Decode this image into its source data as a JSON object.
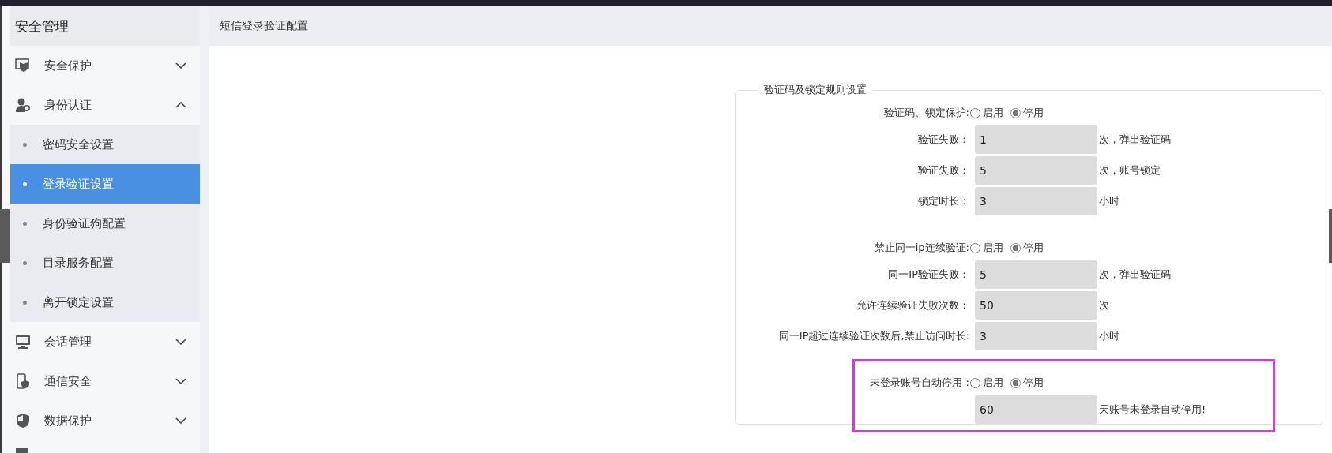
{
  "sidebar": {
    "title": "安全管理",
    "items": [
      {
        "label": "安全保护",
        "expanded": false
      },
      {
        "label": "身份认证",
        "expanded": true,
        "children": [
          {
            "label": "密码安全设置",
            "selected": false
          },
          {
            "label": "登录验证设置",
            "selected": true
          },
          {
            "label": "身份验证狗配置",
            "selected": false
          },
          {
            "label": "目录服务配置",
            "selected": false
          },
          {
            "label": "离开锁定设置",
            "selected": false
          }
        ]
      },
      {
        "label": "会话管理",
        "expanded": false
      },
      {
        "label": "通信安全",
        "expanded": false
      },
      {
        "label": "数据保护",
        "expanded": false
      }
    ]
  },
  "breadcrumb": "短信登录验证配置",
  "fieldset": {
    "legend": "验证码及锁定规则设置",
    "groups": [
      {
        "highlighted": false,
        "rows": [
          {
            "kind": "radio",
            "label": "验证码、锁定保护:",
            "options": [
              {
                "label": "启用",
                "selected": false
              },
              {
                "label": "停用",
                "selected": true
              }
            ]
          },
          {
            "kind": "input",
            "label": "验证失败：",
            "value": "1",
            "suffix": "次，弹出验证码"
          },
          {
            "kind": "input",
            "label": "验证失败：",
            "value": "5",
            "suffix": "次，账号锁定"
          },
          {
            "kind": "input",
            "label": "锁定时长：",
            "value": "3",
            "suffix": "小时"
          }
        ]
      },
      {
        "highlighted": false,
        "rows": [
          {
            "kind": "radio",
            "label": "禁止同一ip连续验证:",
            "options": [
              {
                "label": "启用",
                "selected": false
              },
              {
                "label": "停用",
                "selected": true
              }
            ]
          },
          {
            "kind": "input",
            "label": "同一IP验证失败：",
            "value": "5",
            "suffix": "次，弹出验证码"
          },
          {
            "kind": "input",
            "label": "允许连续验证失败次数：",
            "value": "50",
            "suffix": "次"
          },
          {
            "kind": "input",
            "label": "同一IP超过连续验证次数后,禁止访问时长:",
            "value": "3",
            "suffix": "小时"
          }
        ]
      },
      {
        "highlighted": true,
        "rows": [
          {
            "kind": "radio",
            "label": "未登录账号自动停用 :",
            "options": [
              {
                "label": "启用",
                "selected": false
              },
              {
                "label": "停用",
                "selected": true
              }
            ]
          },
          {
            "kind": "input",
            "value": "60",
            "suffix": "天账号未登录自动停用!"
          }
        ]
      }
    ]
  }
}
